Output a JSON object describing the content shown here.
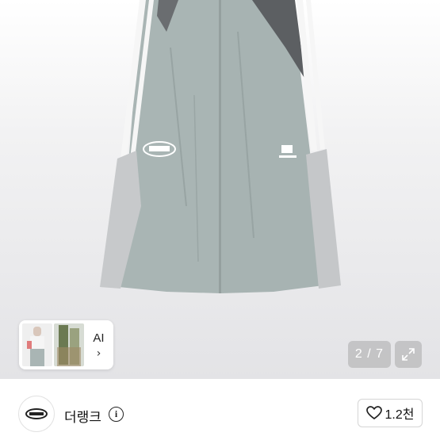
{
  "product": {
    "image_icon": "wide-nylon-track-pants-photo",
    "colors": {
      "pant": "#a9b5b4",
      "panel_light": "#c7c9cb",
      "panel_dark": "#5c5f62",
      "stripe": "#f4f4f4",
      "background": "#e9e9eb"
    }
  },
  "gallery": {
    "ai_label": "AI",
    "chevron": "›",
    "counter": "2 / 7",
    "expand_icon": "expand-arrows-icon"
  },
  "seller": {
    "name": "더랭크",
    "info_glyph": "i",
    "avatar_icon": "brand-logo-icon",
    "like_count": "1.2천",
    "heart_icon": "heart-outline-icon"
  }
}
